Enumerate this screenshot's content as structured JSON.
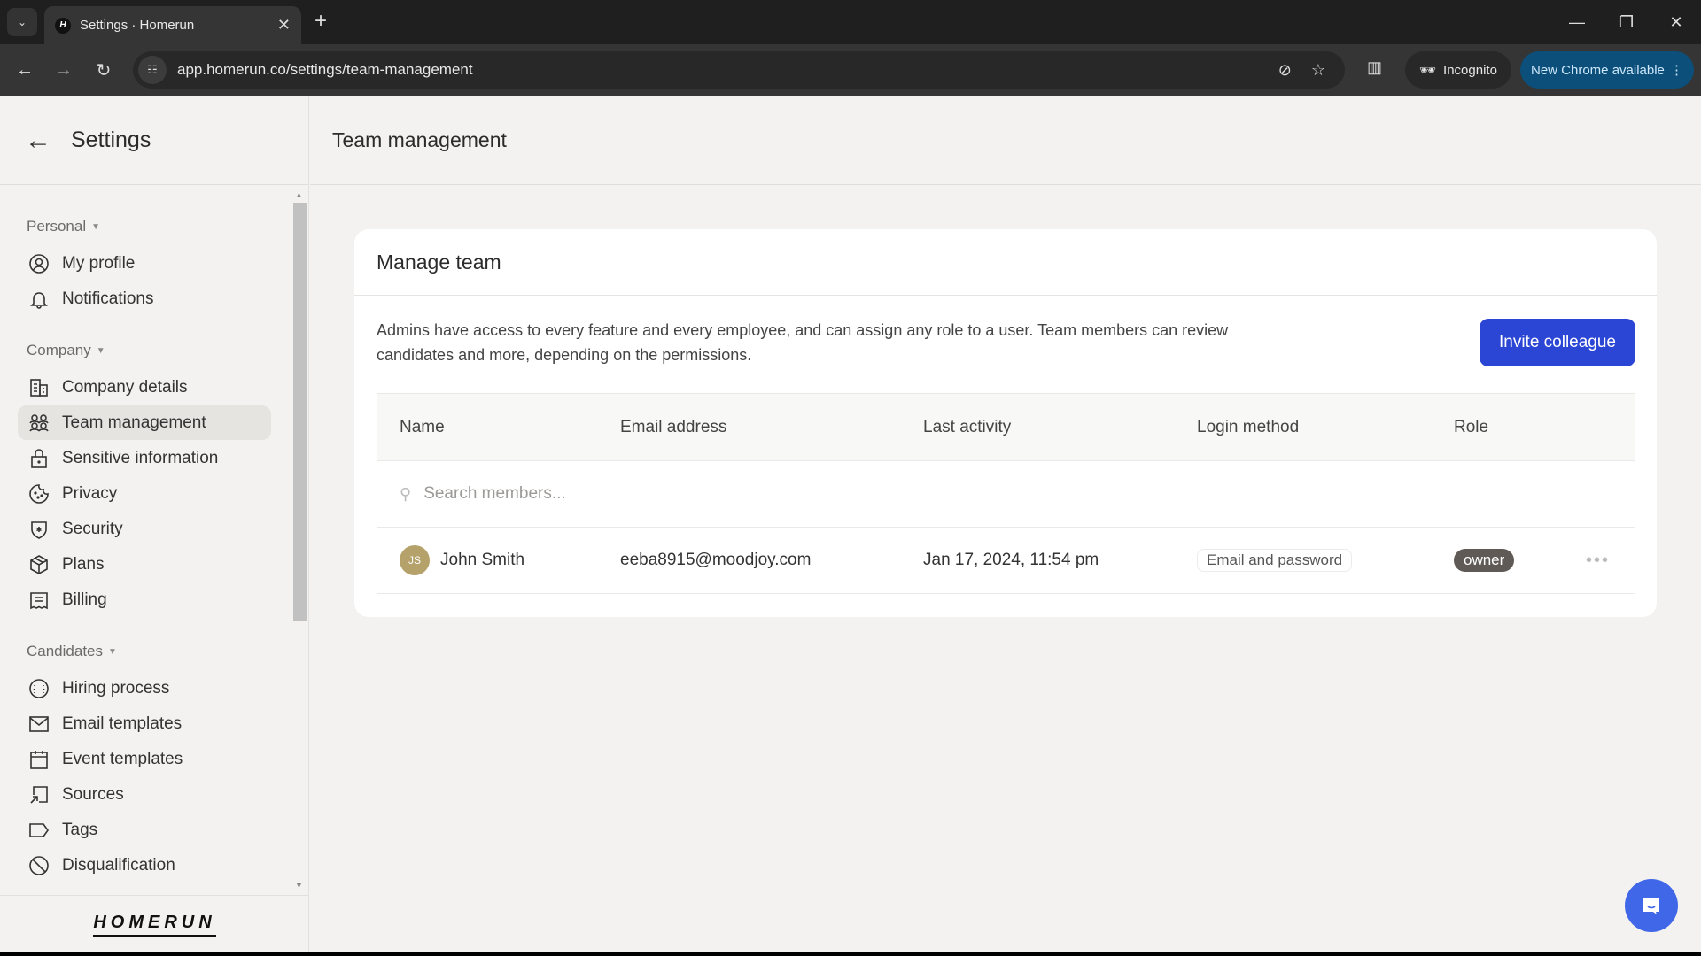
{
  "browser": {
    "tab_title": "Settings · Homerun",
    "favicon_letter": "H",
    "url": "app.homerun.co/settings/team-management",
    "incognito_label": "Incognito",
    "update_label": "New Chrome available"
  },
  "sidebar": {
    "title": "Settings",
    "sections": [
      {
        "label": "Personal",
        "items": [
          {
            "label": "My profile",
            "icon": "user-circle-icon"
          },
          {
            "label": "Notifications",
            "icon": "bell-icon"
          }
        ]
      },
      {
        "label": "Company",
        "items": [
          {
            "label": "Company details",
            "icon": "building-icon"
          },
          {
            "label": "Team management",
            "icon": "team-icon",
            "active": true
          },
          {
            "label": "Sensitive information",
            "icon": "lock-icon"
          },
          {
            "label": "Privacy",
            "icon": "cookie-icon"
          },
          {
            "label": "Security",
            "icon": "shield-icon"
          },
          {
            "label": "Plans",
            "icon": "box-icon"
          },
          {
            "label": "Billing",
            "icon": "receipt-icon"
          }
        ]
      },
      {
        "label": "Candidates",
        "items": [
          {
            "label": "Hiring process",
            "icon": "baseball-icon"
          },
          {
            "label": "Email templates",
            "icon": "mail-icon"
          },
          {
            "label": "Event templates",
            "icon": "calendar-icon"
          },
          {
            "label": "Sources",
            "icon": "source-arrow-icon"
          },
          {
            "label": "Tags",
            "icon": "tag-icon"
          },
          {
            "label": "Disqualification",
            "icon": "ban-icon"
          }
        ]
      }
    ],
    "logo": "HOMERUN"
  },
  "main": {
    "page_title": "Team management",
    "card": {
      "title": "Manage team",
      "description": "Admins have access to every feature and every employee, and can assign any role to a user. Team members can review candidates and more, depending on the permissions.",
      "invite_label": "Invite colleague",
      "search_placeholder": "Search members...",
      "columns": [
        "Name",
        "Email address",
        "Last activity",
        "Login method",
        "Role"
      ],
      "members": [
        {
          "initials": "JS",
          "name": "John Smith",
          "email": "eeba8915@moodjoy.com",
          "last_activity": "Jan 17, 2024, 11:54 pm",
          "login_method": "Email and password",
          "role": "owner",
          "actions": "•••"
        }
      ]
    }
  },
  "colors": {
    "accent": "#2b45d4",
    "avatar": "#b5a16a",
    "role_badge": "#605a57",
    "chat": "#3f67e8"
  }
}
